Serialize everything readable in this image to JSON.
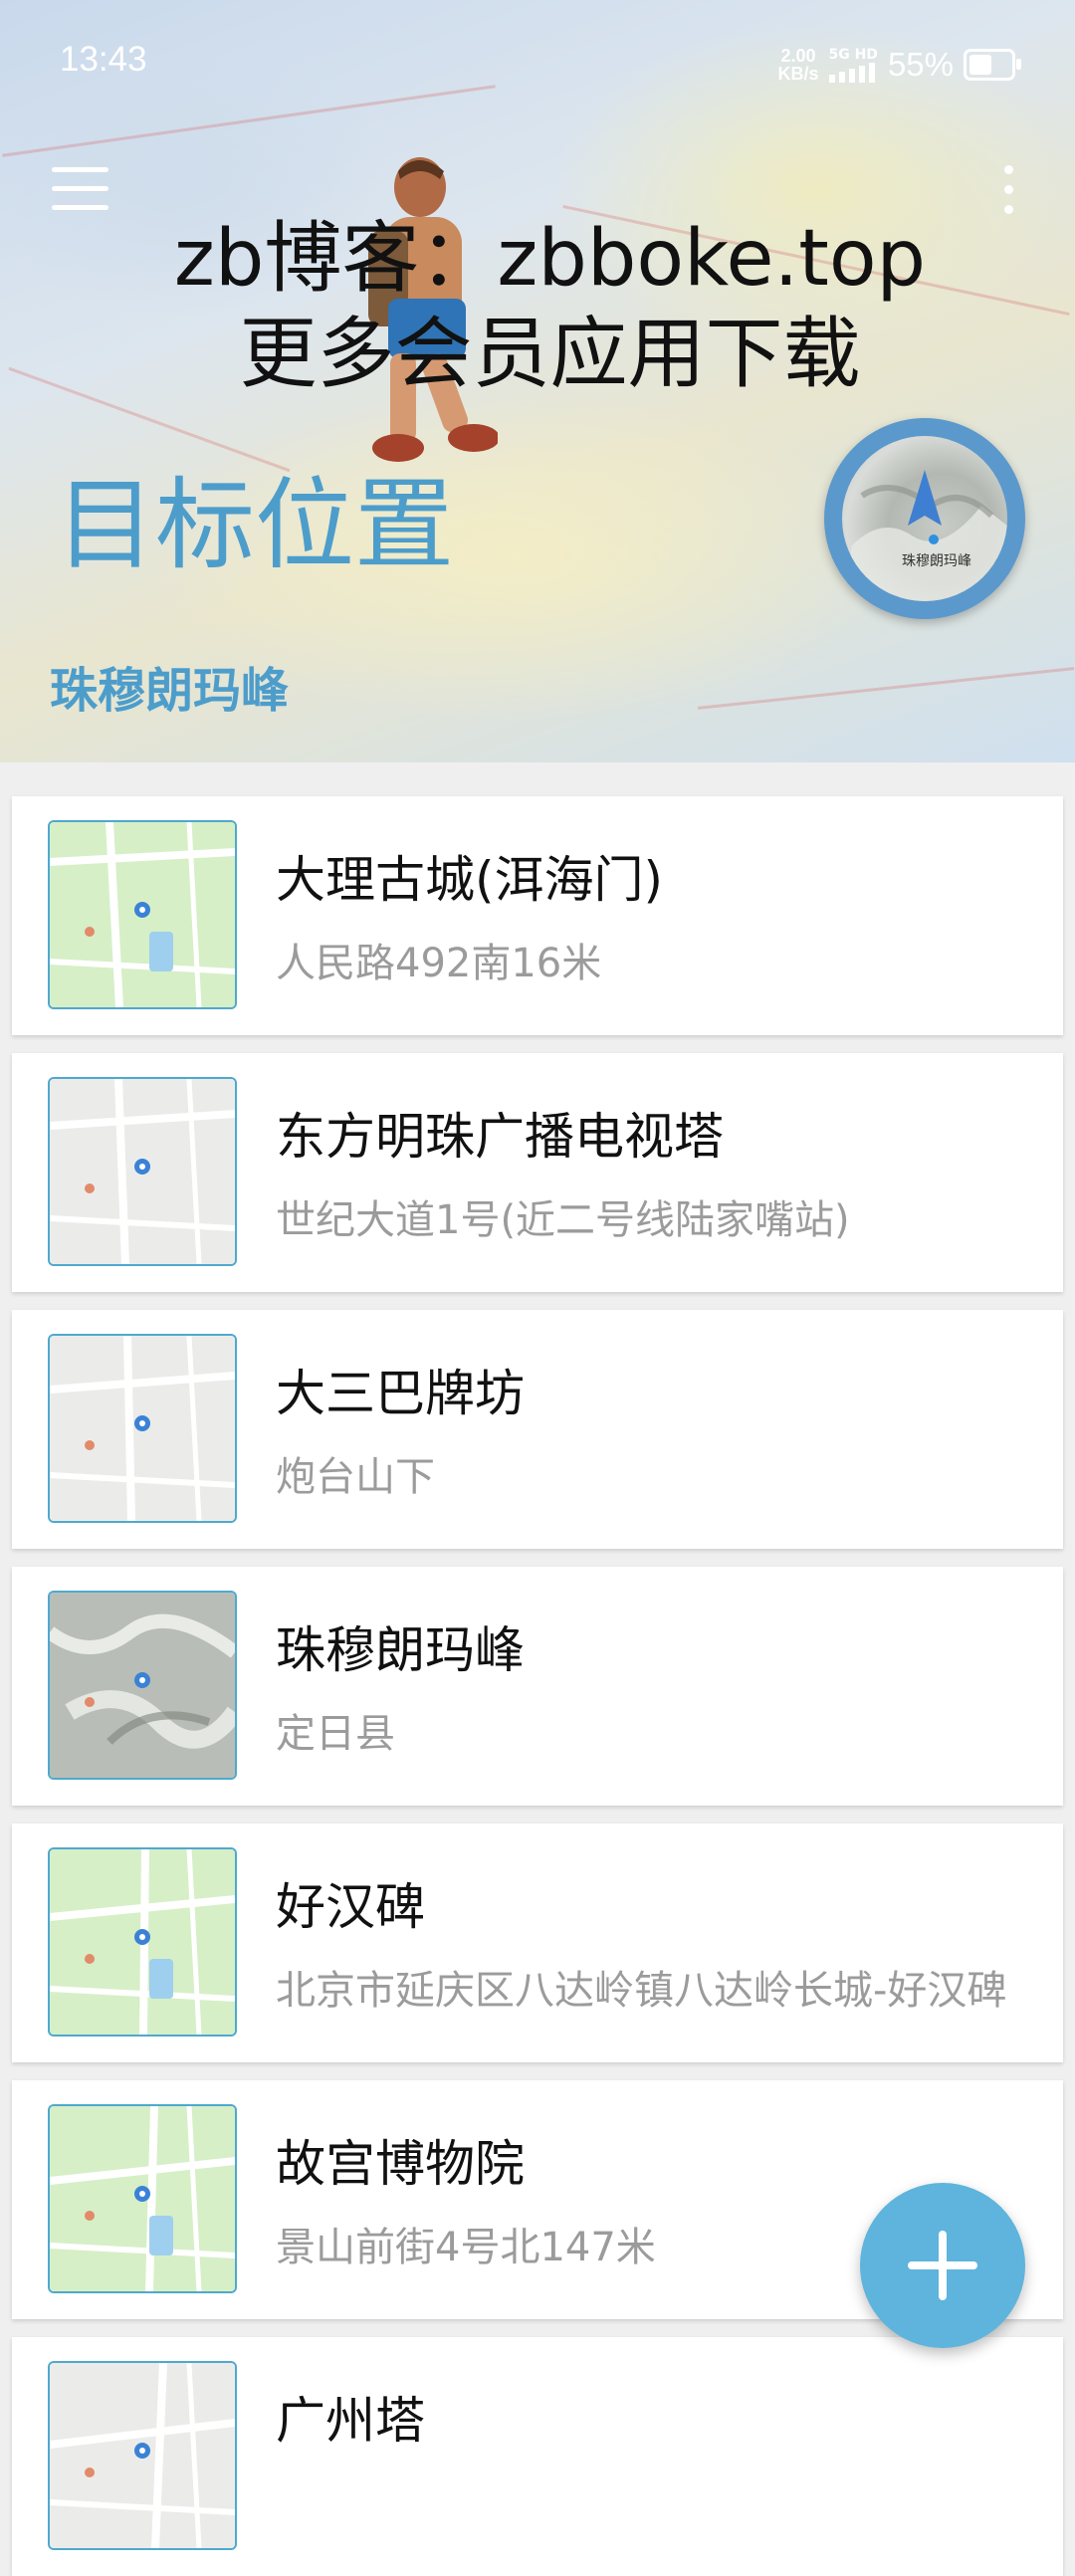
{
  "status_bar": {
    "time": "13:43",
    "net_speed_value": "2.00",
    "net_speed_unit": "KB/s",
    "signal_label": "5G HD",
    "battery_percent": "55%",
    "battery_level": 0.55
  },
  "header": {
    "watermark_line1": "zb博客：zbboke.top",
    "watermark_line2": "更多会员应用下载",
    "title": "目标位置",
    "current_target": "珠穆朗玛峰",
    "menu_icon": "hamburger-menu-icon",
    "more_icon": "more-vertical-icon",
    "compass_icon": "navigation-arrow-icon",
    "compass_map_label": "珠穆朗玛峰"
  },
  "places": [
    {
      "name": "大理古城(洱海门)",
      "address": "人民路492南16米",
      "map_style": "green"
    },
    {
      "name": "东方明珠广播电视塔",
      "address": "世纪大道1号(近二号线陆家嘴站)",
      "map_style": "gray"
    },
    {
      "name": "大三巴牌坊",
      "address": "炮台山下",
      "map_style": "gray"
    },
    {
      "name": "珠穆朗玛峰",
      "address": "定日县",
      "map_style": "terrain"
    },
    {
      "name": "好汉碑",
      "address": "北京市延庆区八达岭镇八达岭长城-好汉碑",
      "map_style": "green"
    },
    {
      "name": "故宫博物院",
      "address": "景山前街4号北147米",
      "map_style": "green"
    },
    {
      "name": "广州塔",
      "address": "",
      "map_style": "gray"
    }
  ],
  "fab": {
    "icon": "plus-icon"
  },
  "colors": {
    "accent": "#4d9dcb",
    "fab": "#5eb4dc",
    "thumb_border": "#4fa9ce",
    "list_bg": "#efefef"
  }
}
